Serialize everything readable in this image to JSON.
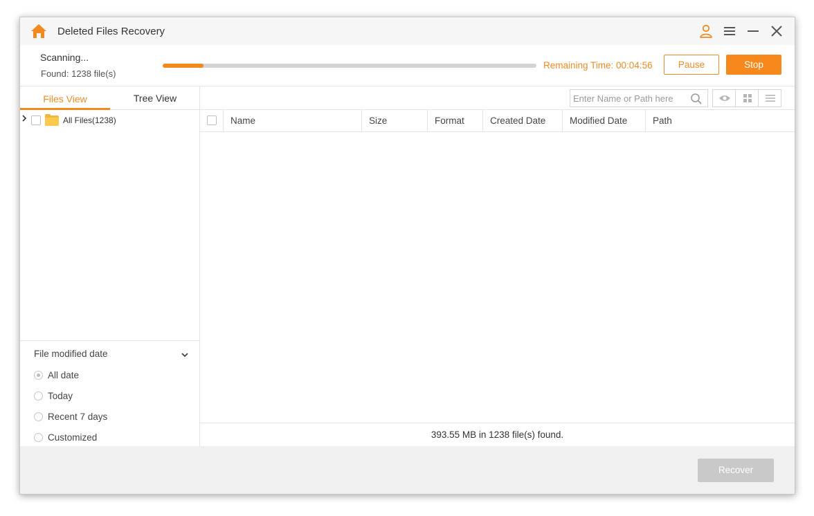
{
  "app": {
    "title": "Deleted Files Recovery",
    "accent_color": "#f18a1e"
  },
  "titlebar": {
    "icons": [
      "home-icon",
      "user-icon",
      "menu-icon",
      "minimize-icon",
      "close-icon"
    ]
  },
  "scan": {
    "status": "Scanning...",
    "found": "Found: 1238 file(s)",
    "progress_fraction": 0.11,
    "remaining": "Remaining Time: 00:04:56",
    "pause_label": "Pause",
    "stop_label": "Stop"
  },
  "left": {
    "tabs": [
      {
        "label": "Files View",
        "active": true
      },
      {
        "label": "Tree View",
        "active": false
      }
    ],
    "tree": {
      "root_label": "All Files(1238)"
    },
    "filter": {
      "title": "File modified date",
      "options": [
        {
          "label": "All date",
          "checked": true
        },
        {
          "label": "Today",
          "checked": false
        },
        {
          "label": "Recent 7 days",
          "checked": false
        },
        {
          "label": "Customized",
          "checked": false
        }
      ]
    }
  },
  "right": {
    "search_placeholder": "Enter Name or Path here",
    "view_buttons": [
      "eye-icon",
      "grid-icon",
      "list-icon"
    ],
    "columns": [
      "Name",
      "Size",
      "Format",
      "Created Date",
      "Modified Date",
      "Path"
    ],
    "rows": [],
    "status": "393.55 MB in 1238 file(s) found."
  },
  "footer": {
    "recover_label": "Recover"
  }
}
